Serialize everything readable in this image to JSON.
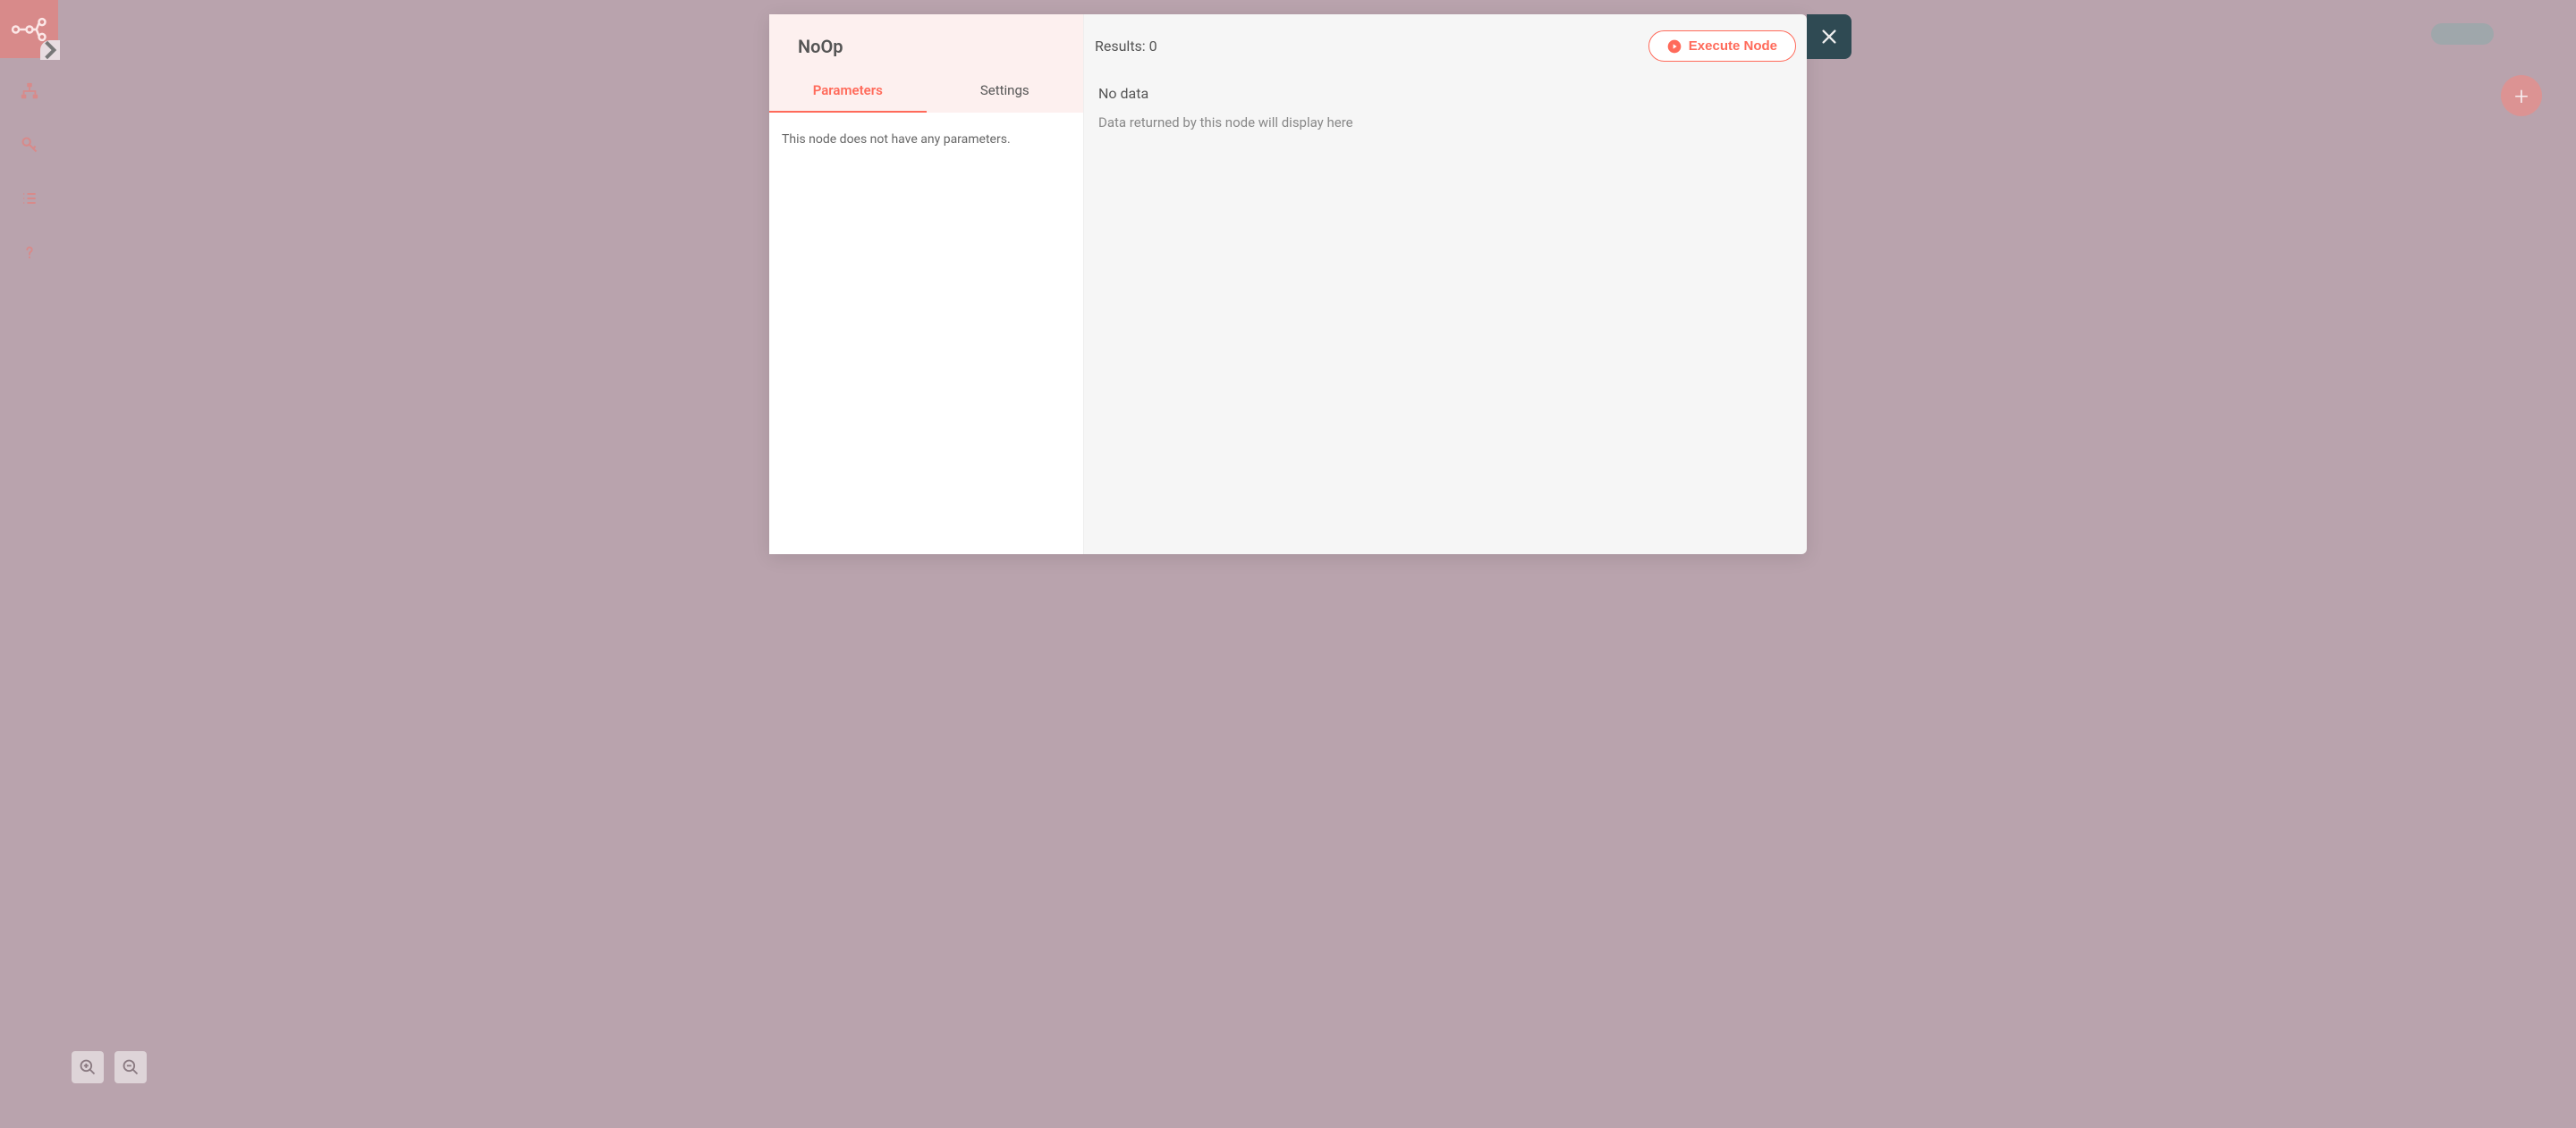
{
  "sidebar": {
    "icons": [
      "workflow-icon",
      "credentials-icon",
      "executions-icon",
      "help-icon"
    ]
  },
  "addButton": {
    "glyph": "+"
  },
  "modal": {
    "title": "NoOp",
    "tabs": {
      "parameters": "Parameters",
      "settings": "Settings"
    },
    "parametersBody": "This node does not have any parameters.",
    "results": {
      "label": "Results: 0",
      "noData": "No data",
      "hint": "Data returned by this node will display here"
    },
    "executeButton": "Execute Node"
  }
}
